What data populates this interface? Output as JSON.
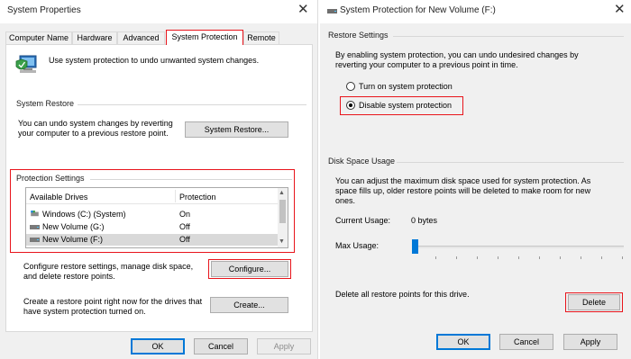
{
  "left_dialog": {
    "title": "System Properties",
    "tabs": [
      {
        "label": "Computer Name"
      },
      {
        "label": "Hardware"
      },
      {
        "label": "Advanced"
      },
      {
        "label": "System Protection"
      },
      {
        "label": "Remote"
      }
    ],
    "active_tab": "System Protection",
    "intro_text": "Use system protection to undo unwanted system changes.",
    "system_restore": {
      "heading": "System Restore",
      "description_line1": "You can undo system changes by reverting",
      "description_line2": "your computer to a previous restore point.",
      "button_label": "System Restore..."
    },
    "protection_settings": {
      "heading": "Protection Settings",
      "columns": [
        "Available Drives",
        "Protection"
      ],
      "drives": [
        {
          "name": "Windows (C:) (System)",
          "protection": "On",
          "icon": "system-drive-icon"
        },
        {
          "name": "New Volume (G:)",
          "protection": "Off",
          "icon": "drive-icon"
        },
        {
          "name": "New Volume (F:)",
          "protection": "Off",
          "icon": "drive-icon",
          "selected": true
        }
      ],
      "configure_text_line1": "Configure restore settings, manage disk space,",
      "configure_text_line2": "and delete restore points.",
      "configure_button": "Configure...",
      "create_text_line1": "Create a restore point right now for the drives that",
      "create_text_line2": "have system protection turned on.",
      "create_button": "Create..."
    },
    "footer_buttons": {
      "ok": "OK",
      "cancel": "Cancel",
      "apply": "Apply"
    }
  },
  "right_dialog": {
    "title": "System Protection for New Volume (F:)",
    "restore_settings": {
      "heading": "Restore Settings",
      "description_line1": "By enabling system protection, you can undo undesired changes by",
      "description_line2": "reverting your computer to a previous point in time.",
      "options": [
        {
          "label": "Turn on system protection",
          "checked": false
        },
        {
          "label": "Disable system protection",
          "checked": true
        }
      ]
    },
    "disk_space": {
      "heading": "Disk Space Usage",
      "description_line1": "You can adjust the maximum disk space used for system protection. As",
      "description_line2": "space fills up, older restore points will be deleted to make room for new",
      "description_line3": "ones.",
      "current_usage_label": "Current Usage:",
      "current_usage_value": "0 bytes",
      "max_usage_label": "Max Usage:",
      "max_usage_fraction": 0,
      "delete_text": "Delete all restore points for this drive.",
      "delete_button": "Delete"
    },
    "footer_buttons": {
      "ok": "OK",
      "cancel": "Cancel",
      "apply": "Apply"
    }
  },
  "colors": {
    "highlight_red": "#e8141b",
    "accent_blue": "#0078d7"
  }
}
